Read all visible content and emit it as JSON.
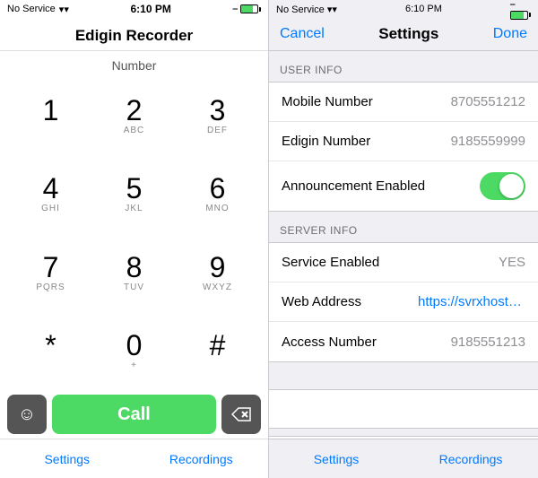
{
  "left": {
    "status_bar": {
      "service": "No Service",
      "wifi": "wifi",
      "time": "6:10 PM",
      "bluetooth": "bluetooth",
      "battery_level": 75
    },
    "app_title": "Edigin Recorder",
    "number_label": "Number",
    "dialpad": [
      {
        "digit": "1",
        "letters": ""
      },
      {
        "digit": "2",
        "letters": "ABC"
      },
      {
        "digit": "3",
        "letters": "DEF"
      },
      {
        "digit": "4",
        "letters": "GHI"
      },
      {
        "digit": "5",
        "letters": "JKL"
      },
      {
        "digit": "6",
        "letters": "MNO"
      },
      {
        "digit": "7",
        "letters": "PQRS"
      },
      {
        "digit": "8",
        "letters": "TUV"
      },
      {
        "digit": "9",
        "letters": "WXYZ"
      },
      {
        "digit": "*",
        "letters": ""
      },
      {
        "digit": "0",
        "letters": "+"
      },
      {
        "digit": "#",
        "letters": ""
      }
    ],
    "call_label": "Call",
    "bottom_tabs": [
      {
        "label": "Settings"
      },
      {
        "label": "Recordings"
      }
    ]
  },
  "right": {
    "status_bar": {
      "service": "No Service",
      "wifi": "wifi",
      "time": "6:10 PM",
      "bluetooth": "bluetooth",
      "battery_level": 75
    },
    "nav": {
      "cancel_label": "Cancel",
      "title": "Settings",
      "done_label": "Done"
    },
    "sections": [
      {
        "header": "USER INFO",
        "rows": [
          {
            "label": "Mobile Number",
            "value": "8705551212",
            "type": "text"
          },
          {
            "label": "Edigin Number",
            "value": "9185559999",
            "type": "text"
          },
          {
            "label": "Announcement Enabled",
            "value": "",
            "type": "toggle",
            "enabled": true
          }
        ]
      },
      {
        "header": "SERVER INFO",
        "rows": [
          {
            "label": "Service Enabled",
            "value": "YES",
            "type": "text"
          },
          {
            "label": "Web Address",
            "value": "https://svrxhosted.ed...",
            "type": "link"
          },
          {
            "label": "Access Number",
            "value": "9185551213",
            "type": "text"
          }
        ]
      }
    ],
    "bottom_tabs": [
      {
        "label": "Settings"
      },
      {
        "label": "Recordings"
      }
    ]
  }
}
